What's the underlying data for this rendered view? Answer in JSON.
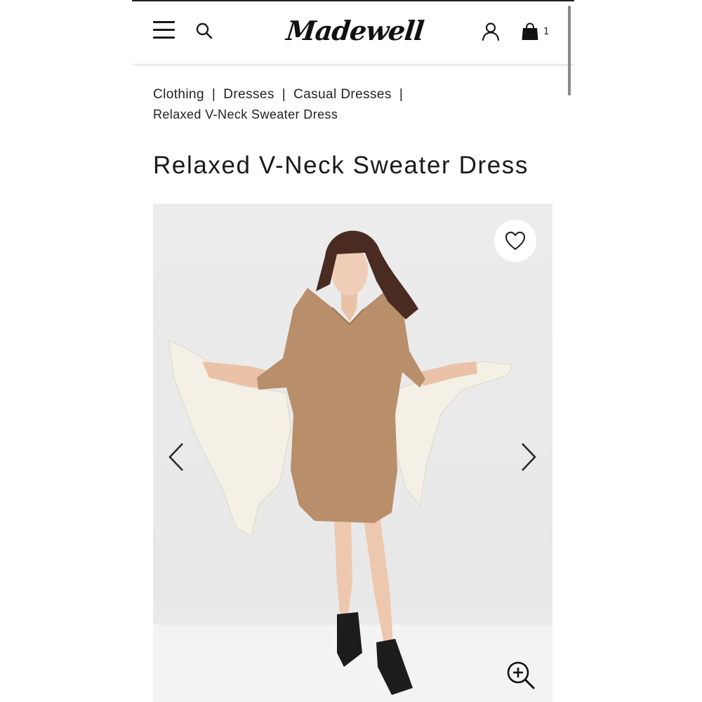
{
  "header": {
    "brand": "Madewell",
    "bag_count": "1",
    "icons": [
      "menu-icon",
      "search-icon",
      "account-icon",
      "shopping-bag-icon"
    ]
  },
  "breadcrumb": {
    "items": [
      "Clothing",
      "Dresses",
      "Casual Dresses"
    ],
    "separator": "|",
    "current": "Relaxed V-Neck Sweater Dress"
  },
  "product": {
    "title": "Relaxed V-Neck Sweater Dress",
    "image_controls": [
      "heart-icon",
      "chevron-left-icon",
      "chevron-right-icon",
      "zoom-in-icon"
    ]
  },
  "colors": {
    "background": "#ffffff",
    "image_background": "#ececec",
    "dress": "#b98e6a",
    "text": "#1f1f1f"
  }
}
